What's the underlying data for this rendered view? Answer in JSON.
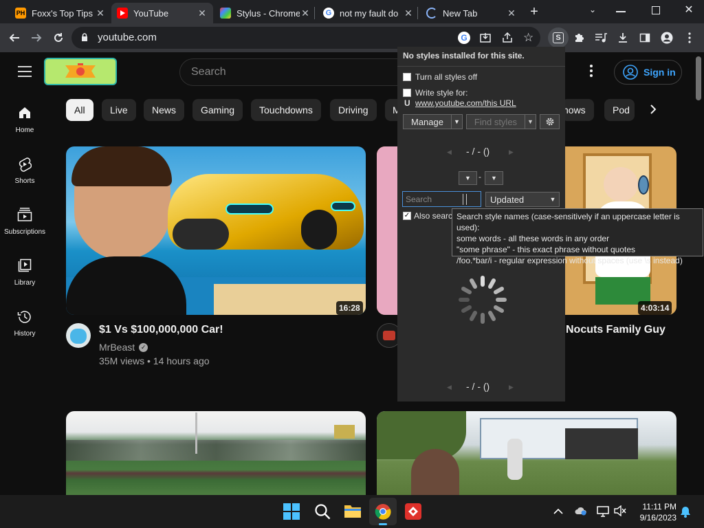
{
  "tabs": [
    {
      "title": "Foxx's Top Tips f",
      "active": false
    },
    {
      "title": "YouTube",
      "active": true
    },
    {
      "title": "Stylus - Chrome",
      "active": false
    },
    {
      "title": "not my fault do",
      "active": false
    },
    {
      "title": "New Tab",
      "active": false
    }
  ],
  "favicon_labels": {
    "ph": "PH"
  },
  "omnibox": {
    "url": "youtube.com"
  },
  "colors": {
    "yt_red": "#ff0000",
    "link_blue": "#3ea6ff",
    "stylus_accent": "#4a90d9"
  },
  "youtube": {
    "search_placeholder": "Search",
    "sign_in": "Sign in",
    "chips": [
      "All",
      "Live",
      "News",
      "Gaming",
      "Touchdowns",
      "Driving",
      "M",
      "hows",
      "Pod"
    ],
    "sidebar": [
      {
        "label": "Home",
        "icon": "home-icon"
      },
      {
        "label": "Shorts",
        "icon": "shorts-icon"
      },
      {
        "label": "Subscriptions",
        "icon": "subscriptions-icon"
      },
      {
        "label": "Library",
        "icon": "library-icon"
      },
      {
        "label": "History",
        "icon": "history-icon"
      }
    ],
    "videos": [
      {
        "title": "$1 Vs $100,000,000 Car!",
        "channel": "MrBeast",
        "meta": "35M views • 14 hours ago",
        "duration": "16:28"
      },
      {
        "title": "Nocuts Family Guy",
        "duration": "4:03:14"
      }
    ]
  },
  "stylus": {
    "header": "No styles installed for this site.",
    "turn_off": "Turn all styles off",
    "write_for": "Write style for:",
    "url_prefix": "U",
    "url_link": "www.youtube.com/this URL",
    "manage": "Manage",
    "find": "Find styles",
    "pager": "- / - ()",
    "dash": "-",
    "search_placeholder": "Search",
    "sort": "Updated",
    "also_search": "Also searc",
    "pager_bottom": "- / - ()"
  },
  "tooltip": [
    "Search style names (case-sensitively if an uppercase letter is used):",
    "some words - all these words in any order",
    "\"some phrase\" - this exact phrase without quotes",
    "/foo.*bar/i - regular expression without spaces (use \\s instead)"
  ],
  "taskbar": {
    "time": "11:11 PM",
    "date": "9/16/2023"
  }
}
